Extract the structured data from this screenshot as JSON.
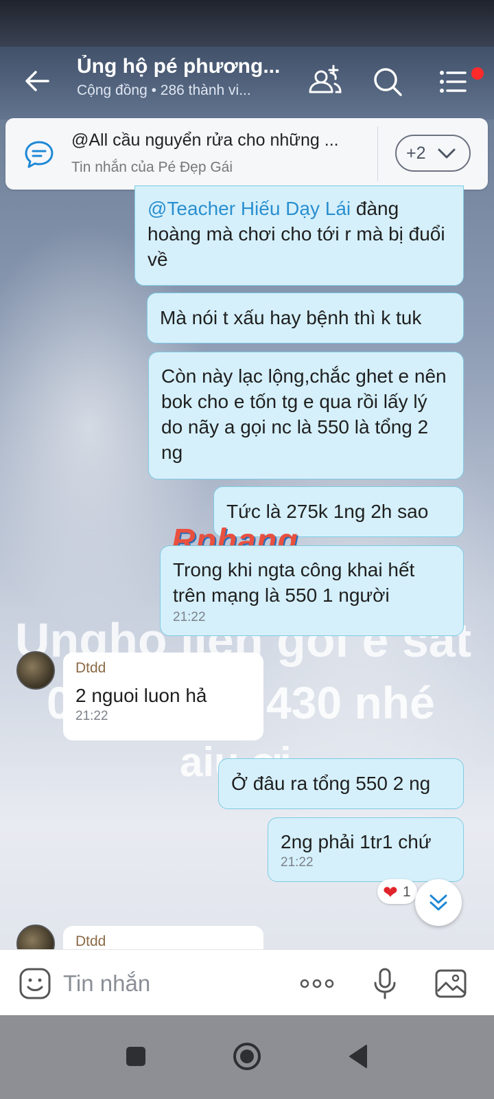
{
  "header": {
    "title": "Ủng hộ pé phương...",
    "subtitle": "Cộng đồng • 286 thành vi..."
  },
  "pinned": {
    "text": "@All cầu nguyển rửa cho những ...",
    "sub": "Tin nhắn của Pé Đẹp Gái",
    "more": "+2"
  },
  "overlay": {
    "line1": "Ungho lien goi e sat",
    "line2": "0",
    "line3": "430 nhé",
    "line4": "aiu ơi"
  },
  "watermark": "Rphang",
  "messages": {
    "m1_mention": "@Teacher Hiếu Dạy Lái",
    "m1_rest": " đàng hoàng mà chơi cho tới r mà bị đuổi về",
    "m2": "Mà nói t xấu hay bệnh thì k tuk",
    "m3": "Còn này lạc lộng,chắc ghet e nên bok cho e tốn tg e qua rồi lấy lý do nãy a gọi nc là 550 là tổng 2 ng",
    "m4": "Tức là 275k 1ng 2h sao",
    "m5": "Trong khi ngta công khai hết trên mạng là 550 1 người",
    "m5_time": "21:22",
    "in1_sender": "Dtdd",
    "in1_text": "2 nguoi luon hả",
    "in1_time": "21:22",
    "m6": "Ở đâu ra tổng 550 2 ng",
    "m7": "2ng phải 1tr1 chứ",
    "m7_time": "21:22",
    "in2_sender": "Dtdd"
  },
  "reaction": {
    "heart": "❤",
    "count": "1"
  },
  "input": {
    "placeholder": "Tin nhắn"
  }
}
